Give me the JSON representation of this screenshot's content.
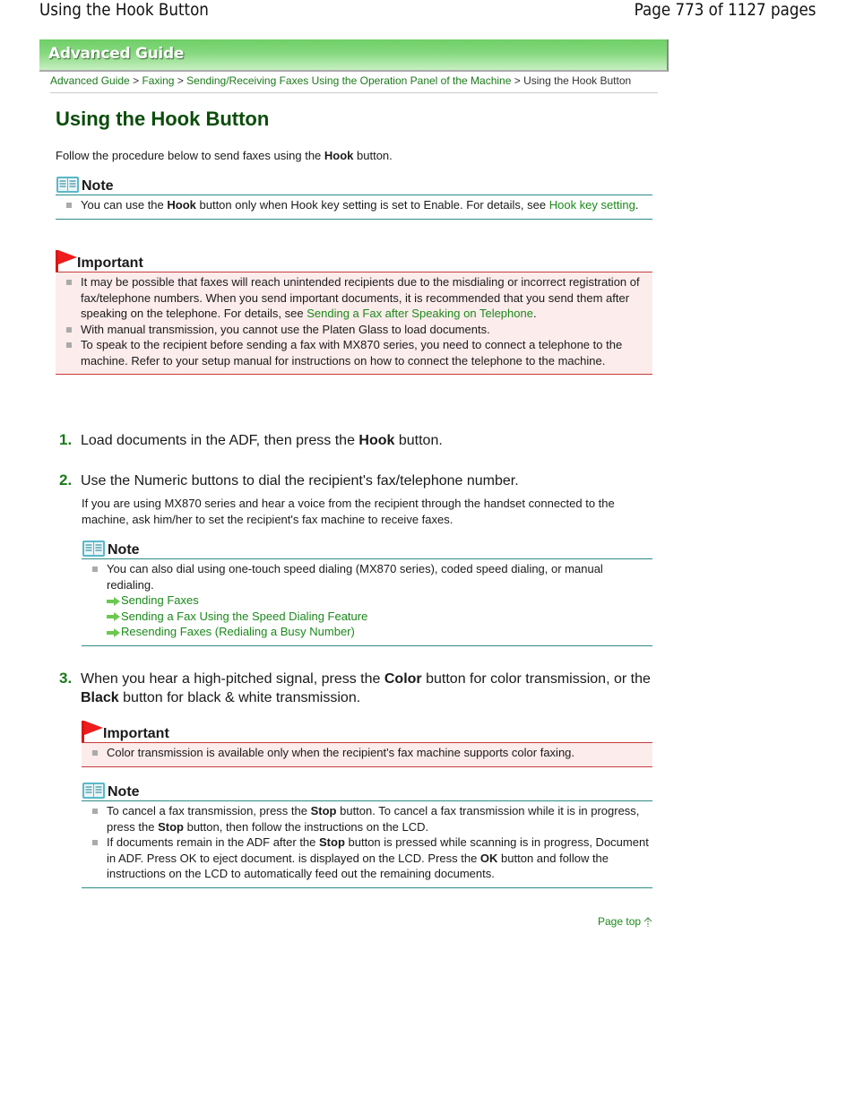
{
  "pdf_header": {
    "title": "Using the Hook Button",
    "page_info": "Page 773 of 1127 pages"
  },
  "banner": {
    "label": "Advanced Guide"
  },
  "breadcrumb": {
    "items": [
      "Advanced Guide",
      "Faxing",
      "Sending/Receiving Faxes Using the Operation Panel of the Machine"
    ],
    "current": "Using the Hook Button",
    "separator": ">"
  },
  "page": {
    "title": "Using the Hook Button",
    "intro": {
      "before": "Follow the procedure below to send faxes using the ",
      "bold": "Hook",
      "after": " button."
    }
  },
  "note1": {
    "heading": "Note",
    "item": {
      "before": "You can use the ",
      "bold": "Hook",
      "middle": " button only when Hook key setting is set to Enable. For details, see ",
      "link": "Hook key setting",
      "after": "."
    }
  },
  "important1": {
    "heading": "Important",
    "items": [
      {
        "text": "It may be possible that faxes will reach unintended recipients due to the misdialing or incorrect registration of fax/telephone numbers. When you send important documents, it is recommended that you send them after speaking on the telephone. For details, see ",
        "link": "Sending a Fax after Speaking on Telephone",
        "after": "."
      },
      {
        "text": "With manual transmission, you cannot use the Platen Glass to load documents."
      },
      {
        "text": "To speak to the recipient before sending a fax with MX870 series, you need to connect a telephone to the machine. Refer to your setup manual for instructions on how to connect the telephone to the machine."
      }
    ]
  },
  "steps": [
    {
      "num": "1.",
      "before": "Load documents in the ADF, then press the ",
      "bold": "Hook",
      "after": " button."
    },
    {
      "num": "2.",
      "text": "Use the Numeric buttons to dial the recipient's fax/telephone number.",
      "detail": "If you are using MX870 series and hear a voice from the recipient through the handset connected to the machine, ask him/her to set the recipient's fax machine to receive faxes."
    },
    {
      "num": "3.",
      "before": "When you hear a high-pitched signal, press the ",
      "bold": "Color",
      "middle": " button for color transmission, or the ",
      "bold2": "Black",
      "after": " button for black & white transmission."
    }
  ],
  "note2": {
    "heading": "Note",
    "item": "You can also dial using one-touch speed dialing (MX870 series), coded speed dialing, or manual redialing.",
    "links": [
      "Sending Faxes",
      "Sending a Fax Using the Speed Dialing Feature",
      "Resending Faxes (Redialing a Busy Number)"
    ]
  },
  "important2": {
    "heading": "Important",
    "item": "Color transmission is available only when the recipient's fax machine supports color faxing."
  },
  "note3": {
    "heading": "Note",
    "items": [
      {
        "a": "To cancel a fax transmission, press the ",
        "b": "Stop",
        "c": " button. To cancel a fax transmission while it is in progress, press the ",
        "d": "Stop",
        "e": " button, then follow the instructions on the LCD."
      },
      {
        "a": "If documents remain in the ADF after the ",
        "b": "Stop",
        "c": " button is pressed while scanning is in progress, Document in ADF. Press OK to eject document. is displayed on the LCD. Press the ",
        "d": "OK",
        "e": " button and follow the instructions on the LCD to automatically feed out the remaining documents."
      }
    ]
  },
  "footer": {
    "page_top": "Page top"
  },
  "colors": {
    "link": "#1a8a1a",
    "title": "#0b4d0b",
    "note_rule": "#2e8b85",
    "important_rule": "#c83c3c",
    "important_bg": "#fdecec"
  }
}
